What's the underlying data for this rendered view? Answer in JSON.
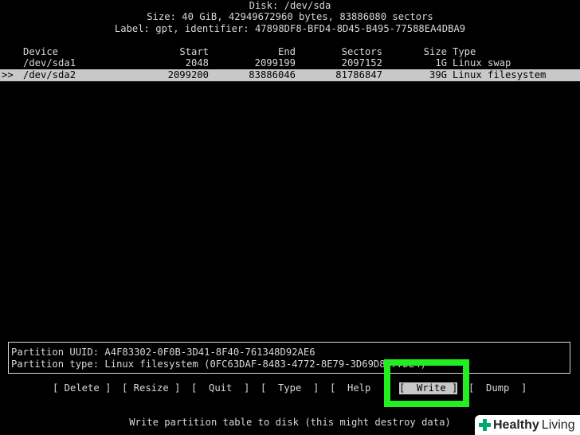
{
  "header": {
    "disk_title": "Disk: /dev/sda",
    "size_line": "Size: 40 GiB, 42949672960 bytes, 83886080 sectors",
    "label_line": "Label: gpt, identifier: 47898DF8-BFD4-8D45-B495-77588EA4DBA9"
  },
  "table": {
    "columns": {
      "device": "Device",
      "start": "Start",
      "end": "End",
      "sectors": "Sectors",
      "size": "Size",
      "type": "Type"
    },
    "rows": [
      {
        "marker": "",
        "device": "/dev/sda1",
        "start": "2048",
        "end": "2099199",
        "sectors": "2097152",
        "size": "1G",
        "type": "Linux swap"
      },
      {
        "marker": ">>",
        "device": "/dev/sda2",
        "start": "2099200",
        "end": "83886046",
        "sectors": "81786847",
        "size": "39G",
        "type": "Linux filesystem"
      }
    ]
  },
  "info": {
    "uuid_line": "Partition UUID: A4F83302-0F0B-3D41-8F40-761348D92AE6",
    "type_line": "Partition type: Linux filesystem (0FC63DAF-8483-4772-8E79-3D69D8477DE4)"
  },
  "menu": {
    "delete": "[ Delete ]",
    "resize": "[ Resize ]",
    "quit": "[  Quit  ]",
    "type": "[  Type  ]",
    "help": "[  Help  ]",
    "write": "[  Write ]",
    "dump": "[  Dump  ]"
  },
  "hint": "Write partition table to disk (this might destroy data)",
  "watermark": {
    "word1": "Healthy",
    "word2": "Living"
  },
  "colors": {
    "background": "#000000",
    "text": "#d8d8d8",
    "selection": "#c8c8c8",
    "highlight": "#22ee22",
    "watermark_plus": "#00a86b"
  }
}
